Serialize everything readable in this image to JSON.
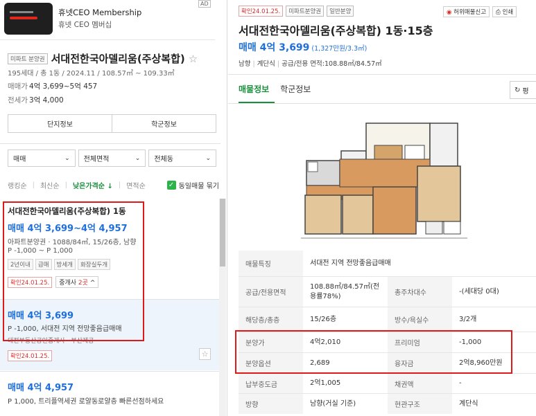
{
  "ad": {
    "badge": "AD",
    "title": "휴넷CEO Membership",
    "subtitle": "휴넷 CEO 멤버십"
  },
  "summary": {
    "tag": "미파트 분양권",
    "name": "서대전한국아델리움(주상복합)",
    "info": "195세대 / 총 1동 / 2024.11 / 108.57㎡ ~ 109.33㎡",
    "sale_label": "매매가",
    "sale_value": "4억 3,699~5억 457",
    "jeonse_label": "전세가",
    "jeonse_value": "3억 4,000",
    "btn_complex": "단지정보",
    "btn_school": "학군정보"
  },
  "filters": {
    "trade": "매매",
    "area": "전체면적",
    "dong": "전체동"
  },
  "sort": {
    "items": [
      "랭킹순",
      "최신순",
      "낮은가격순 ↓",
      "면적순"
    ],
    "same_listing": "동일매물 묶기"
  },
  "listings": [
    {
      "title": "서대전한국아델리움(주상복합) 1동",
      "price": "매매 4억 3,699~4억 4,957",
      "spec": "아파트분양권 · 1088/84㎡, 15/26층, 남향",
      "jeonse": "P -1,000 ~ P 1,000",
      "tags": [
        "2년이내",
        "급매",
        "방세개",
        "화장실두개"
      ],
      "confirm": "확인24.01.25.",
      "agent_prefix": "중개사",
      "agent_count": "2곳",
      "agent_suffix": "^"
    },
    {
      "price": "매매 4억 3,699",
      "desc": "P -1,000, 서대전 지역 전망좋음급매매",
      "cut": "대전부동산공인중개사 · 부산제공",
      "confirm": "확인24.01.25."
    },
    {
      "price": "매매 4억 4,957",
      "desc": "P 1,000, 트리플역세권 로얄동로얄층 빠른선점하세요"
    }
  ],
  "detail": {
    "confirm": "확인24.01.25.",
    "tag1": "미파트분양권",
    "tag2": "일반분양",
    "report": "허위매물신고",
    "print": "인쇄",
    "title": "서대전한국아델리움(주상복합) 1동·15층",
    "price": "매매 4억 3,699",
    "per": "(1,327만원/3.3㎡)",
    "info_dir": "남향",
    "info_struct": "계단식",
    "info_area": "공급/전용 면적:108.88㎡/84.57㎡",
    "tab_listing": "매물정보",
    "tab_school": "학군정보",
    "refresh": "평"
  },
  "table": [
    {
      "k1": "매물특징",
      "v1": "서대전 지역 전망좋음급매매",
      "k2": "",
      "v2": ""
    },
    {
      "k1": "공급/전용면적",
      "v1": "108.88㎡/84.57㎡(전용률78%)",
      "k2": "총주차대수",
      "v2": "-(세대당 0대)"
    },
    {
      "k1": "해당층/총층",
      "v1": "15/26층",
      "k2": "방수/욕실수",
      "v2": "3/2개"
    },
    {
      "k1": "분양가",
      "v1": "4억2,010",
      "k2": "프리미엄",
      "v2": "-1,000"
    },
    {
      "k1": "분양옵션",
      "v1": "2,689",
      "k2": "융자금",
      "v2": "2억8,960만원"
    },
    {
      "k1": "납부중도금",
      "v1": "2억1,005",
      "k2": "채권액",
      "v2": "-"
    },
    {
      "k1": "방향",
      "v1": "남향(거실 기준)",
      "k2": "현관구조",
      "v2": "계단식"
    }
  ],
  "colors": {
    "price_blue": "#1e6fd9",
    "active_green": "#1b8f3d",
    "highlight_red": "#e01818"
  }
}
